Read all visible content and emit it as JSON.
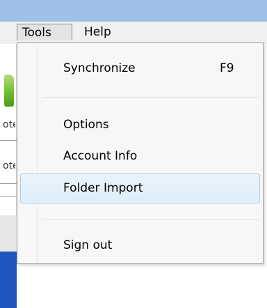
{
  "menubar": {
    "items": [
      {
        "label": "Tools"
      },
      {
        "label": "Help"
      }
    ]
  },
  "background": {
    "text_1": "ote",
    "text_2": "ote"
  },
  "dropdown": {
    "items": [
      {
        "label": "Synchronize",
        "shortcut": "F9"
      },
      {
        "label": "Options"
      },
      {
        "label": "Account Info"
      },
      {
        "label": "Folder Import"
      },
      {
        "label": "Sign out"
      }
    ],
    "hovered_item": "Folder Import"
  },
  "colors": {
    "titlebar": "#9fc0e6",
    "menubar": "#f0f0f0",
    "hover_border": "#a8cde9",
    "hover_fill": "#dfeef9",
    "background_accent": "#1e56c0"
  }
}
